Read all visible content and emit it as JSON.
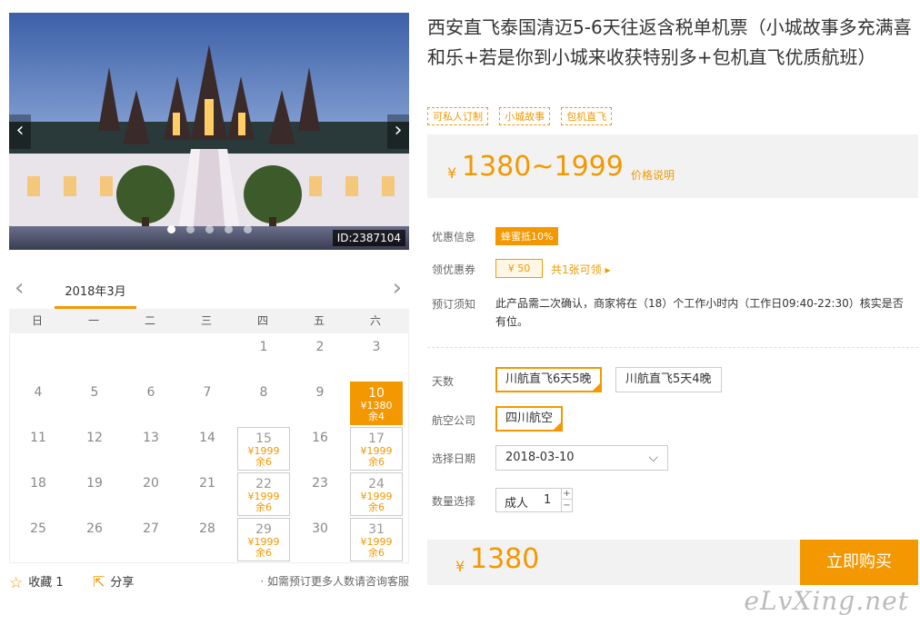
{
  "hero": {
    "id_label": "ID:2387104",
    "prev_arrow": "‹",
    "next_arrow": "›",
    "dot_count": 5,
    "active_dot": 0
  },
  "calendar": {
    "month": "2018年3月",
    "prev": "‹",
    "next": "›",
    "weekdays": [
      "日",
      "一",
      "二",
      "三",
      "四",
      "五",
      "六"
    ],
    "leading_blanks": 4,
    "days": [
      {
        "d": "1"
      },
      {
        "d": "2"
      },
      {
        "d": "3"
      },
      {
        "d": "4"
      },
      {
        "d": "5"
      },
      {
        "d": "6"
      },
      {
        "d": "7"
      },
      {
        "d": "8"
      },
      {
        "d": "9"
      },
      {
        "d": "10",
        "price": "¥1380",
        "left": "余4",
        "selected": true
      },
      {
        "d": "11"
      },
      {
        "d": "12"
      },
      {
        "d": "13"
      },
      {
        "d": "14"
      },
      {
        "d": "15",
        "price": "¥1999",
        "left": "余6"
      },
      {
        "d": "16"
      },
      {
        "d": "17",
        "price": "¥1999",
        "left": "余6"
      },
      {
        "d": "18"
      },
      {
        "d": "19"
      },
      {
        "d": "20"
      },
      {
        "d": "21"
      },
      {
        "d": "22",
        "price": "¥1999",
        "left": "余6"
      },
      {
        "d": "23"
      },
      {
        "d": "24",
        "price": "¥1999",
        "left": "余6"
      },
      {
        "d": "25"
      },
      {
        "d": "26"
      },
      {
        "d": "27"
      },
      {
        "d": "28"
      },
      {
        "d": "29",
        "price": "¥1999",
        "left": "余6"
      },
      {
        "d": "30"
      },
      {
        "d": "31",
        "price": "¥1999",
        "left": "余6"
      }
    ]
  },
  "footer": {
    "favorite_label": "收藏 1",
    "share_label": "分享",
    "hint": "· 如需预订更多人数请咨询客服"
  },
  "product": {
    "title": "西安直飞泰国清迈5-6天往返含税单机票（小城故事多充满喜和乐+若是你到小城来收获特别多+包机直飞优质航班）",
    "tags": [
      "可私人订制",
      "小城故事",
      "包机直飞"
    ],
    "price_currency": "¥",
    "price_range": "1380~1999",
    "price_note": "价格说明"
  },
  "info": {
    "promo_label": "优惠信息",
    "promo_badge": "蜂蜜抵10%",
    "coupon_label": "领优惠券",
    "coupon_value": "¥ 50",
    "coupon_link": "共1张可领 ▸",
    "notice_label": "预订须知",
    "notice_text": "此产品需二次确认，商家将在（18）个工作小时内（工作日09:40-22:30）核实是否有位。"
  },
  "options": {
    "days_label": "天数",
    "days": [
      {
        "label": "川航直飞6天5晚",
        "selected": true
      },
      {
        "label": "川航直飞5天4晚",
        "selected": false
      }
    ],
    "airline_label": "航空公司",
    "airline": {
      "label": "四川航空",
      "selected": true
    },
    "date_label": "选择日期",
    "date_value": "2018-03-10",
    "qty_label": "数量选择",
    "qty_type": "成人",
    "qty_value": "1",
    "qty_plus": "+",
    "qty_minus": "−"
  },
  "buy": {
    "currency": "¥",
    "total": "1380",
    "button": "立即购买"
  },
  "watermark": "eLvXing.net",
  "colors": {
    "accent": "#f39800",
    "panel": "#f2f2f2"
  }
}
